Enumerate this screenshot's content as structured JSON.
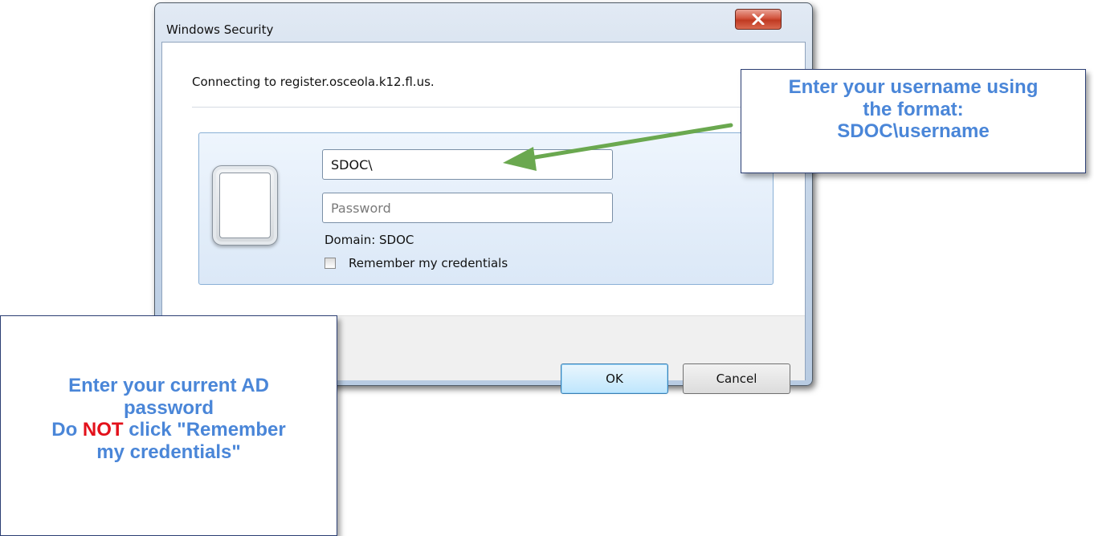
{
  "window": {
    "title": "Windows Security",
    "close_glyph": "X",
    "connecting_text": "Connecting to register.osceola.k12.fl.us."
  },
  "credentials": {
    "username_value": "SDOC\\",
    "password_placeholder": "Password",
    "domain_text": "Domain: SDOC",
    "remember_label": "Remember my credentials",
    "remember_checked": false
  },
  "buttons": {
    "ok_label": "OK",
    "cancel_label": "Cancel"
  },
  "callouts": {
    "username": {
      "line1": "Enter your username using",
      "line2": "the format:",
      "line3": "SDOC\\username"
    },
    "password": {
      "line1": "Enter your current AD",
      "line2": "password",
      "line3_prefix": "Do ",
      "line3_emphasis": "NOT",
      "line3_suffix": " click \"Remember",
      "line4": "my credentials\""
    }
  },
  "colors": {
    "callout_text": "#4a86d8",
    "emphasis": "#e3111b",
    "arrow": "#6aa84f"
  }
}
